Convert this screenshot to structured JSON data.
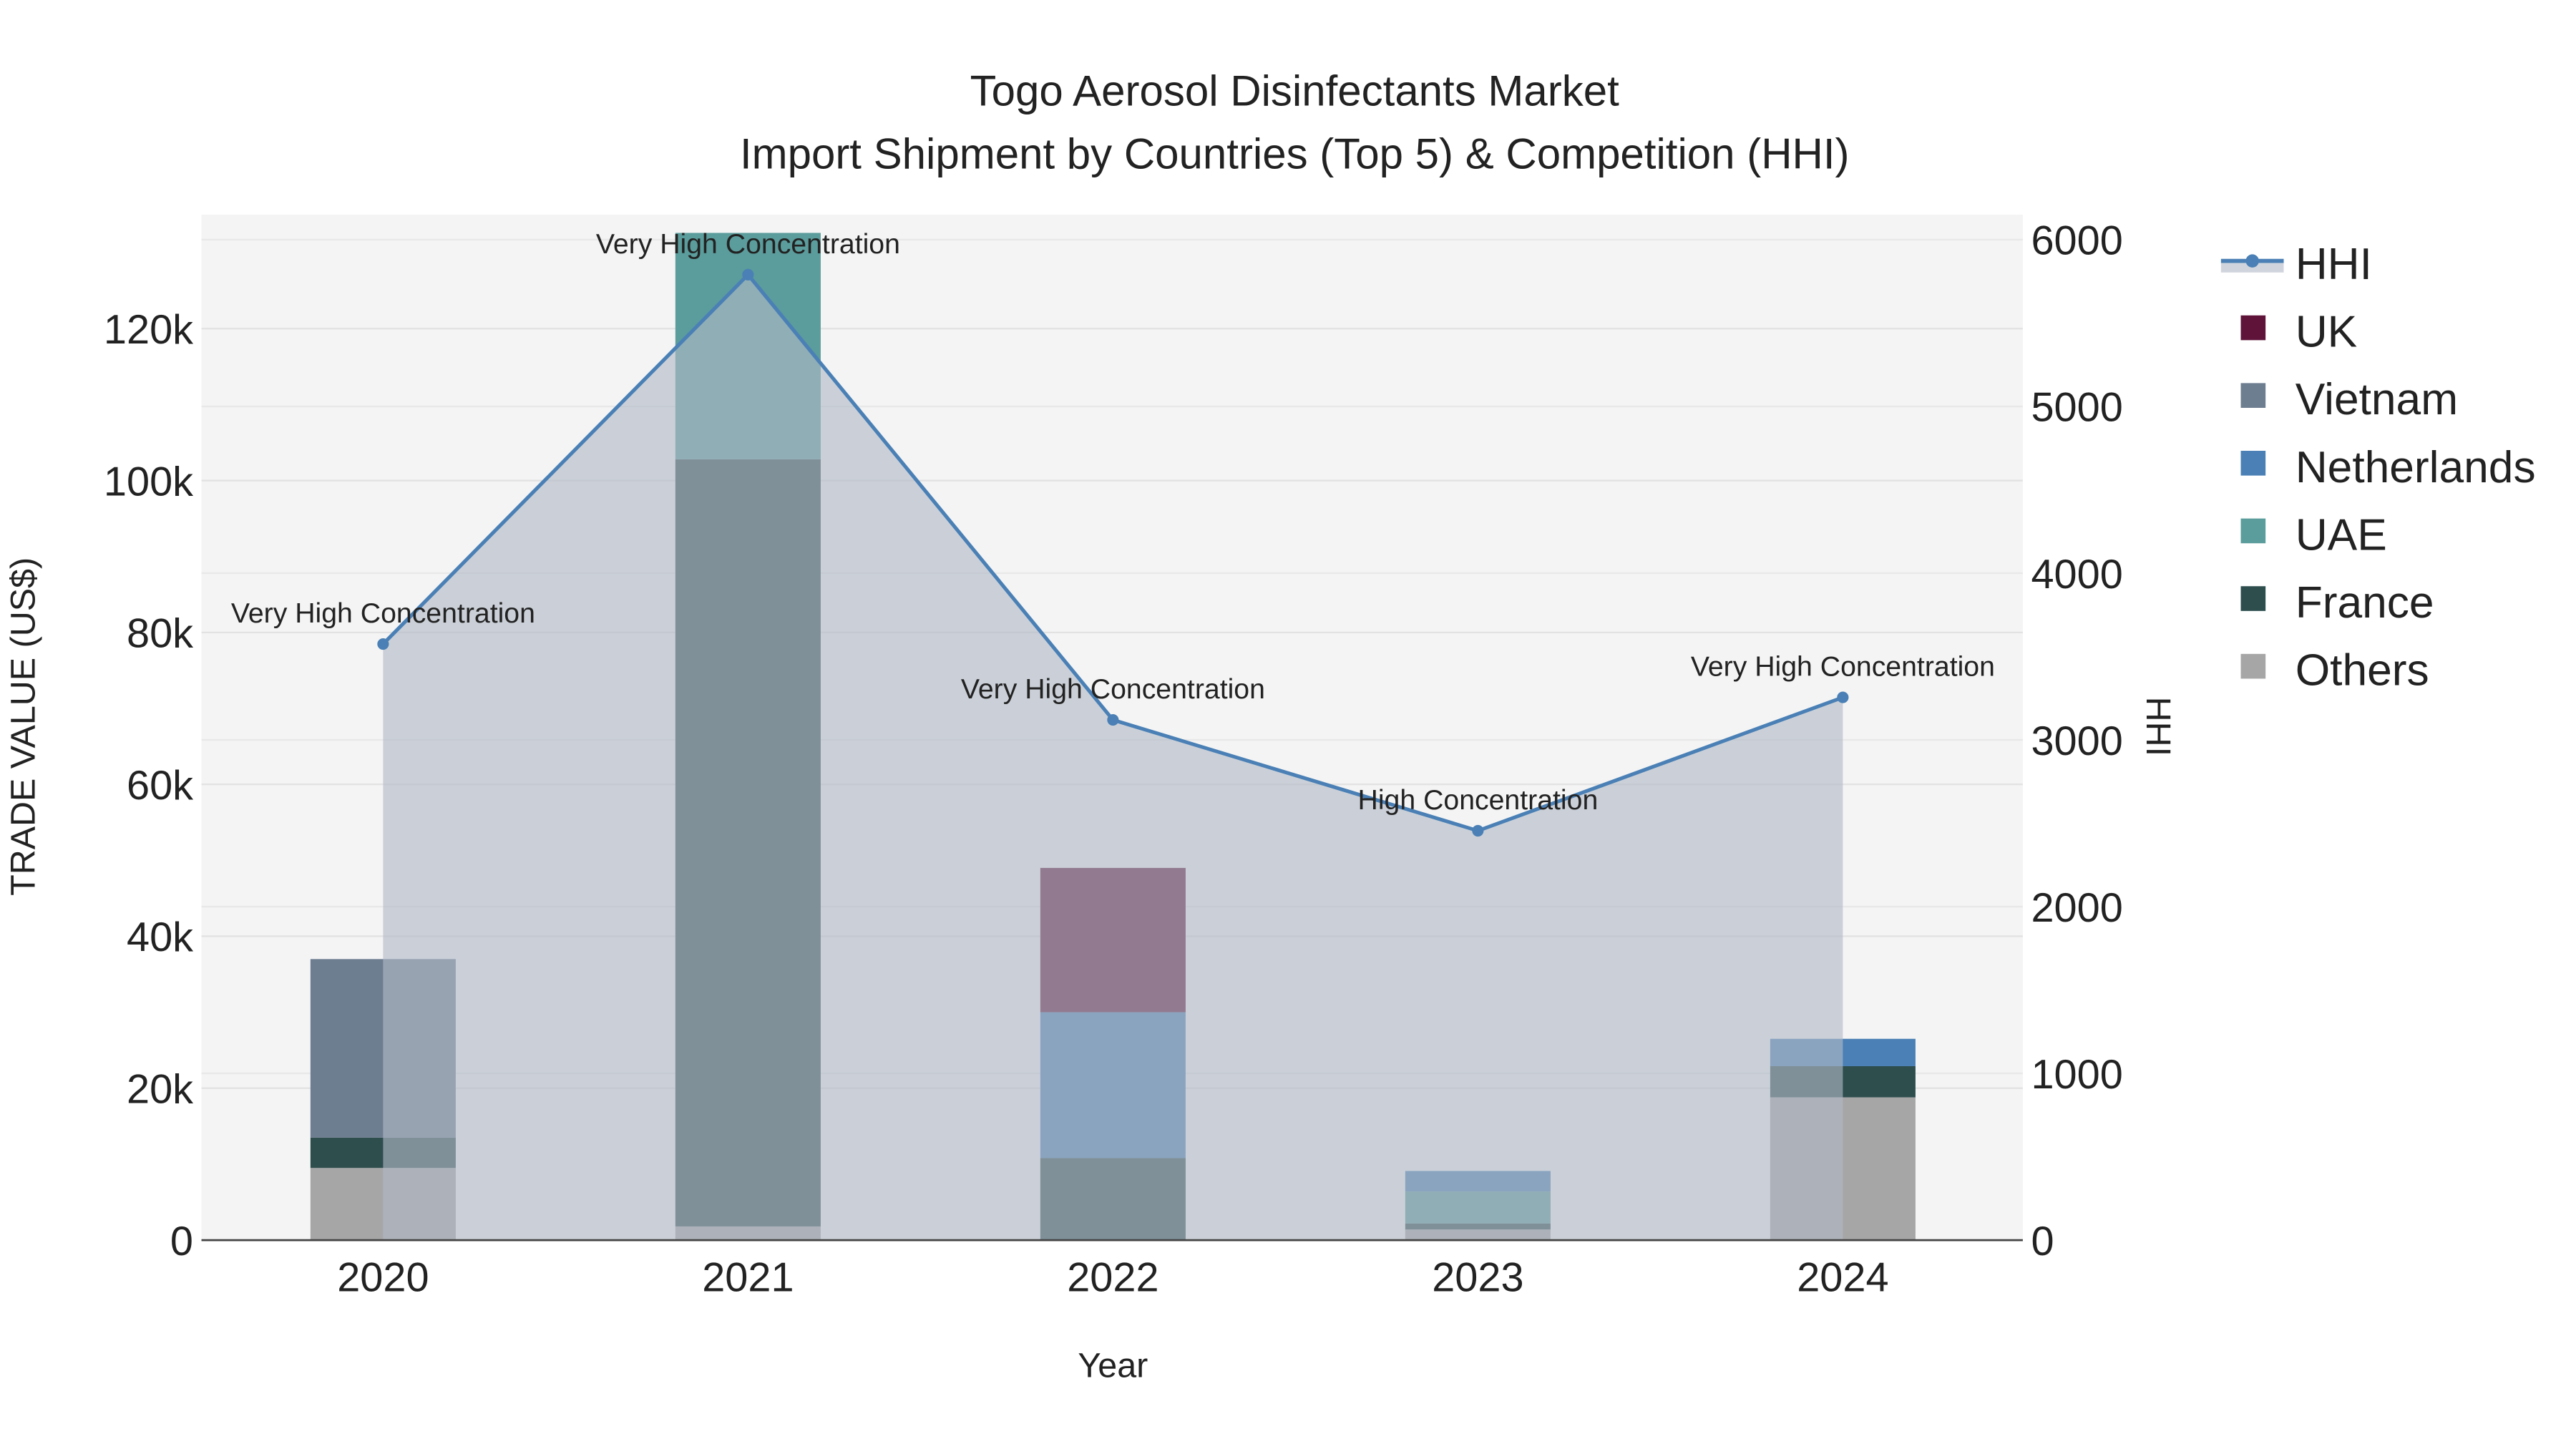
{
  "chart_data": {
    "type": "bar",
    "title": "Togo Aerosol Disinfectants Market",
    "subtitle": "Import Shipment by Countries (Top 5) & Competition (HHI)",
    "xlabel": "Year",
    "ylabel": "TRADE VALUE (US$)",
    "y2label": "HHI",
    "categories": [
      "2020",
      "2021",
      "2022",
      "2023",
      "2024"
    ],
    "ylim": [
      0,
      135000
    ],
    "y2lim": [
      0,
      6150
    ],
    "yticks": [
      0,
      20000,
      40000,
      60000,
      80000,
      100000,
      120000
    ],
    "ytick_labels": [
      "0",
      "20k",
      "40k",
      "60k",
      "80k",
      "100k",
      "120k"
    ],
    "y2ticks": [
      0,
      1000,
      2000,
      3000,
      4000,
      5000,
      6000
    ],
    "y2tick_labels": [
      "0",
      "1000",
      "2000",
      "3000",
      "4000",
      "5000",
      "6000"
    ],
    "grid": true,
    "legend_placement": "right",
    "stack_order": [
      "Others",
      "France",
      "UAE",
      "Netherlands",
      "Vietnam",
      "UK"
    ],
    "series": [
      {
        "name": "UK",
        "color": "#5f1339",
        "values": [
          0,
          0,
          19000,
          0,
          0
        ]
      },
      {
        "name": "Vietnam",
        "color": "#6e7e91",
        "values": [
          23500,
          0,
          0,
          0,
          0
        ]
      },
      {
        "name": "Netherlands",
        "color": "#4a80b5",
        "values": [
          0,
          0,
          19200,
          2700,
          3600
        ]
      },
      {
        "name": "UAE",
        "color": "#5b9c9c",
        "values": [
          0,
          29800,
          0,
          4200,
          0
        ]
      },
      {
        "name": "France",
        "color": "#2e4e4e",
        "values": [
          4000,
          101000,
          10800,
          800,
          4100
        ]
      },
      {
        "name": "Others",
        "color": "#a6a6a6",
        "values": [
          9500,
          1800,
          0,
          1400,
          18800
        ]
      }
    ],
    "hhi": {
      "name": "HHI",
      "color": "#4a80b5",
      "values": [
        3575,
        5790,
        3120,
        2455,
        3255
      ],
      "annotations": [
        "Very High Concentration",
        "Very High Concentration",
        "Very High Concentration",
        "High Concentration",
        "Very High Concentration"
      ]
    }
  }
}
